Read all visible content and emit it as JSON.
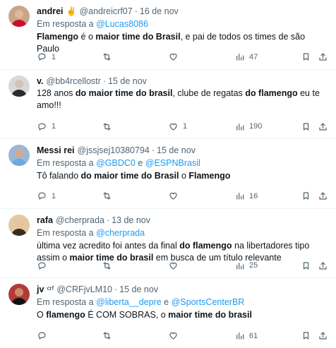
{
  "tweets": [
    {
      "name": "andrei",
      "emoji": "✌️",
      "handle": "@andreicrf07",
      "date": "16 de nov",
      "reply_prefix": "Em resposta a",
      "mentions": [
        "@Lucas8086"
      ],
      "body": [
        {
          "b": true,
          "t": "Flamengo"
        },
        {
          "b": false,
          "t": " é o "
        },
        {
          "b": true,
          "t": "maior time do Brasil"
        },
        {
          "b": false,
          "t": ", e pai de todos os times de são Paulo"
        }
      ],
      "replies": "1",
      "retweets": "",
      "likes": "",
      "views": "47"
    },
    {
      "name": "v.",
      "emoji": "",
      "handle": "@bb4rcellostr",
      "date": "15 de nov",
      "reply_prefix": "",
      "mentions": [],
      "body": [
        {
          "b": false,
          "t": "128 anos "
        },
        {
          "b": true,
          "t": "do maior time do brasil"
        },
        {
          "b": false,
          "t": ", clube de regatas "
        },
        {
          "b": true,
          "t": "do flamengo"
        },
        {
          "b": false,
          "t": " eu te amo!!!"
        }
      ],
      "replies": "1",
      "retweets": "",
      "likes": "1",
      "views": "190"
    },
    {
      "name": "Messi rei",
      "emoji": "",
      "handle": "@jssjsej10380794",
      "date": "15 de nov",
      "reply_prefix": "Em resposta a",
      "mentions": [
        "@GBDC0",
        "@ESPNBrasil"
      ],
      "body": [
        {
          "b": false,
          "t": "Tô falando "
        },
        {
          "b": true,
          "t": "do maior time do Brasil"
        },
        {
          "b": false,
          "t": " o "
        },
        {
          "b": true,
          "t": "Flamengo"
        }
      ],
      "replies": "1",
      "retweets": "",
      "likes": "",
      "views": "16"
    },
    {
      "name": "rafa",
      "emoji": "",
      "handle": "@cherprada",
      "date": "13 de nov",
      "reply_prefix": "Em resposta a",
      "mentions": [
        "@cherprada"
      ],
      "body": [
        {
          "b": false,
          "t": "última vez acredito foi antes da final "
        },
        {
          "b": true,
          "t": "do flamengo"
        },
        {
          "b": false,
          "t": " na libertadores tipo assim o "
        },
        {
          "b": true,
          "t": "maior time do brasil"
        },
        {
          "b": false,
          "t": " em busca de um título relevante"
        }
      ],
      "replies": "",
      "retweets": "",
      "likes": "",
      "views": "25"
    },
    {
      "name": "jv",
      "emoji": "ᶜʳᶠ",
      "handle": "@CRFjvLM10",
      "date": "15 de nov",
      "reply_prefix": "Em resposta a",
      "mentions": [
        "@liberta__depre",
        "@SportsCenterBR"
      ],
      "body": [
        {
          "b": false,
          "t": "O "
        },
        {
          "b": true,
          "t": "flamengo"
        },
        {
          "b": false,
          "t": " É COM SOBRAS, o "
        },
        {
          "b": true,
          "t": "maior time do brasil"
        }
      ],
      "replies": "",
      "retweets": "",
      "likes": "",
      "views": "61"
    }
  ],
  "reply_joiner": "e",
  "icons": {
    "reply": "reply-icon",
    "retweet": "retweet-icon",
    "like": "heart-icon",
    "views": "views-icon",
    "bookmark": "bookmark-icon",
    "share": "share-icon"
  },
  "colors": {
    "link": "#1d9bf0",
    "secondary": "#536471",
    "text": "#0f1419",
    "divider": "#eff3f4"
  },
  "avatars": [
    {
      "bg": "#c9a58a",
      "skin": "#e0b89a",
      "shirt": "#c8102e"
    },
    {
      "bg": "#d8d8d8",
      "skin": "#cfc4bc",
      "shirt": "#2b2b2b"
    },
    {
      "bg": "#9bb7d4",
      "skin": "#d6a88a",
      "shirt": "#6fa8dc"
    },
    {
      "bg": "#e3c9a0",
      "skin": "#e8c29b",
      "shirt": "#3b2a1e"
    },
    {
      "bg": "#b33a3a",
      "skin": "#c98b6b",
      "shirt": "#111111"
    }
  ]
}
